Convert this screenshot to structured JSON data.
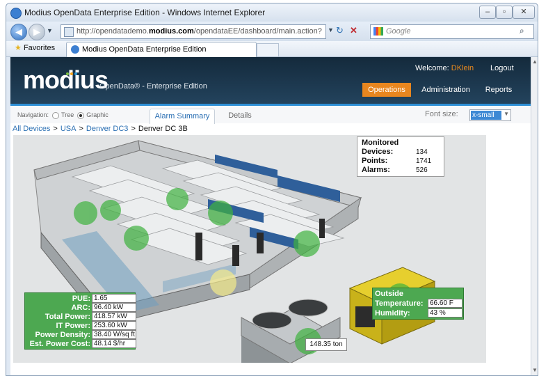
{
  "browser": {
    "title": "Modius OpenData Enterprise Edition - Windows Internet Explorer",
    "url_prefix": "http://opendatademo.",
    "url_host": "modius.com",
    "url_suffix": "/opendataEE/dashboard/main.action?treeN",
    "search_placeholder": "Google",
    "favorites_label": "Favorites",
    "tab_title": "Modius OpenData Enterprise Edition"
  },
  "header": {
    "logo": "modius",
    "logo_dot_colors": [
      "#7ec242",
      "#f3a21c",
      "#2f9ad7",
      "#c0c0c0"
    ],
    "subtitle": "OpenData® - Enterprise Edition",
    "welcome_label": "Welcome: ",
    "username": "DKlein",
    "logout": "Logout",
    "nav": [
      "Operations",
      "Administration",
      "Reports"
    ]
  },
  "toolbar": {
    "navigation_label": "Navigation:",
    "tree_label": "Tree",
    "graphic_label": "Graphic",
    "tabs": [
      "Alarm Summary",
      "Details"
    ],
    "font_size_label": "Font size:",
    "font_size_value": "x-small"
  },
  "breadcrumb": [
    "All Devices",
    "USA",
    "Denver DC3",
    "Denver DC 3B"
  ],
  "monitored": {
    "title": "Monitored",
    "devices_label": "Devices:",
    "devices": "134",
    "points_label": "Points:",
    "points": "1741",
    "alarms_label": "Alarms:",
    "alarms": "526"
  },
  "power": {
    "labels": [
      "PUE:",
      "ARC:",
      "Total Power:",
      "IT Power:",
      "Power Density:",
      "Est. Power Cost:"
    ],
    "values": [
      "1.65",
      "96.40 kW",
      "418.57 kW",
      "253.60 kW",
      "38.40 W/sq ft",
      "48.14 $/hr"
    ]
  },
  "outside": {
    "title": "Outside",
    "temperature_label": "Temperature:",
    "temperature": "66.60 F",
    "humidity_label": "Humidity:",
    "humidity": "43 %"
  },
  "chiller_tonnage": "148.35 ton",
  "colors": {
    "header_bg": "#142a3c",
    "accent_orange": "#e8861f",
    "status_green": "#4da851",
    "status_yellow": "#f3e98a"
  }
}
